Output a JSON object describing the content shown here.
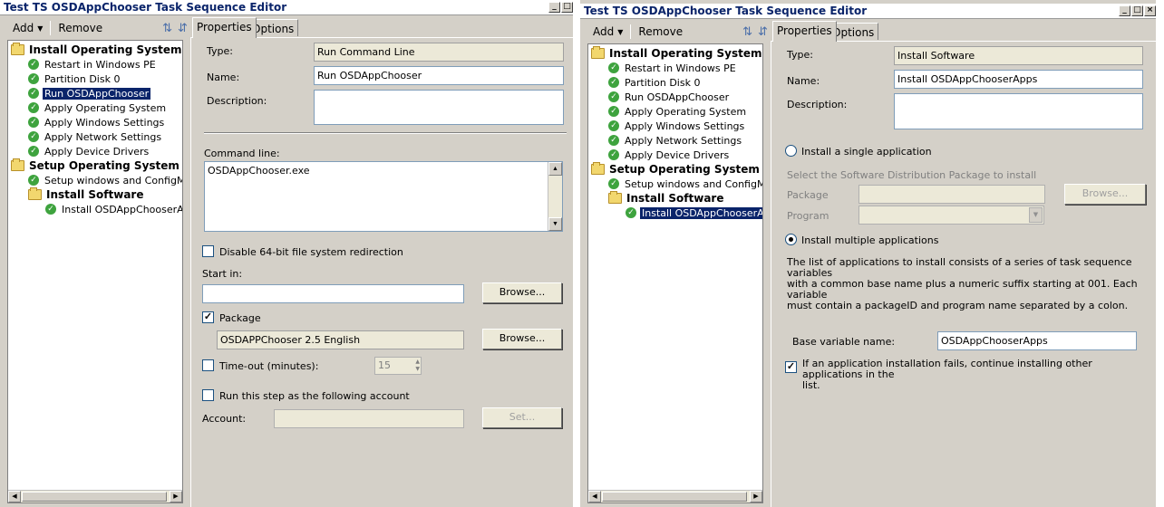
{
  "windows": [
    {
      "title": "Test TS OSDAppChooser Task Sequence Editor",
      "toolbar": {
        "add_label": "Add",
        "remove_label": "Remove"
      },
      "tree": [
        {
          "label": "Install Operating System",
          "kind": "group",
          "level": 0
        },
        {
          "label": "Restart in Windows PE",
          "kind": "step",
          "level": 1
        },
        {
          "label": "Partition Disk 0",
          "kind": "step",
          "level": 1
        },
        {
          "label": "Run OSDAppChooser",
          "kind": "step",
          "level": 1,
          "selected": true
        },
        {
          "label": "Apply Operating System",
          "kind": "step",
          "level": 1
        },
        {
          "label": "Apply Windows Settings",
          "kind": "step",
          "level": 1
        },
        {
          "label": "Apply Network Settings",
          "kind": "step",
          "level": 1
        },
        {
          "label": "Apply Device Drivers",
          "kind": "step",
          "level": 1
        },
        {
          "label": "Setup Operating System",
          "kind": "group",
          "level": 0
        },
        {
          "label": "Setup windows and ConfigMgr",
          "kind": "step",
          "level": 1
        },
        {
          "label": "Install Software",
          "kind": "group",
          "level": 1
        },
        {
          "label": "Install OSDAppChooserApps",
          "kind": "step",
          "level": 2
        }
      ],
      "tabs": [
        "Properties",
        "Options"
      ],
      "props": {
        "type_label": "Type:",
        "type_value": "Run Command Line",
        "name_label": "Name:",
        "name_value": "Run OSDAppChooser",
        "description_label": "Description:",
        "command_line_label": "Command line:",
        "command_line_value": "OSDAppChooser.exe",
        "disable_redirection_label": "Disable 64-bit file system redirection",
        "start_in_label": "Start in:",
        "browse_label": "Browse...",
        "package_label": "Package",
        "package_value": "OSDAPPChooser 2.5 English",
        "timeout_label": "Time-out (minutes):",
        "timeout_value": "15",
        "run_as_label": "Run this step as the following account",
        "account_label": "Account:",
        "set_label": "Set..."
      }
    },
    {
      "title": "Test TS OSDAppChooser Task Sequence Editor",
      "toolbar": {
        "add_label": "Add",
        "remove_label": "Remove"
      },
      "tree": [
        {
          "label": "Install Operating System",
          "kind": "group",
          "level": 0
        },
        {
          "label": "Restart in Windows PE",
          "kind": "step",
          "level": 1
        },
        {
          "label": "Partition Disk 0",
          "kind": "step",
          "level": 1
        },
        {
          "label": "Run OSDAppChooser",
          "kind": "step",
          "level": 1
        },
        {
          "label": "Apply Operating System",
          "kind": "step",
          "level": 1
        },
        {
          "label": "Apply Windows Settings",
          "kind": "step",
          "level": 1
        },
        {
          "label": "Apply Network Settings",
          "kind": "step",
          "level": 1
        },
        {
          "label": "Apply Device Drivers",
          "kind": "step",
          "level": 1
        },
        {
          "label": "Setup Operating System",
          "kind": "group",
          "level": 0
        },
        {
          "label": "Setup windows and ConfigMgr",
          "kind": "step",
          "level": 1
        },
        {
          "label": "Install Software",
          "kind": "group",
          "level": 1
        },
        {
          "label": "Install OSDAppChooserApps",
          "kind": "step",
          "level": 2,
          "selected": true
        }
      ],
      "tabs": [
        "Properties",
        "Options"
      ],
      "props": {
        "type_label": "Type:",
        "type_value": "Install Software",
        "name_label": "Name:",
        "name_value": "Install OSDAppChooserApps",
        "description_label": "Description:",
        "single_app_label": "Install a single application",
        "select_package_label": "Select the Software Distribution Package to install",
        "package_label": "Package",
        "program_label": "Program",
        "browse_label": "Browse...",
        "multiple_apps_label": "Install multiple applications",
        "multi_desc_line1": "The list of applications to install consists of a series of task sequence variables",
        "multi_desc_line2": "with a common base name plus a numeric suffix starting at 001.  Each variable",
        "multi_desc_line3": "must contain a packageID and program name separated by a colon.",
        "base_var_label": "Base variable name:",
        "base_var_value": "OSDAppChooserApps",
        "continue_label_line1": "If an application installation fails, continue installing other applications in the",
        "continue_label_line2": "list."
      }
    }
  ]
}
